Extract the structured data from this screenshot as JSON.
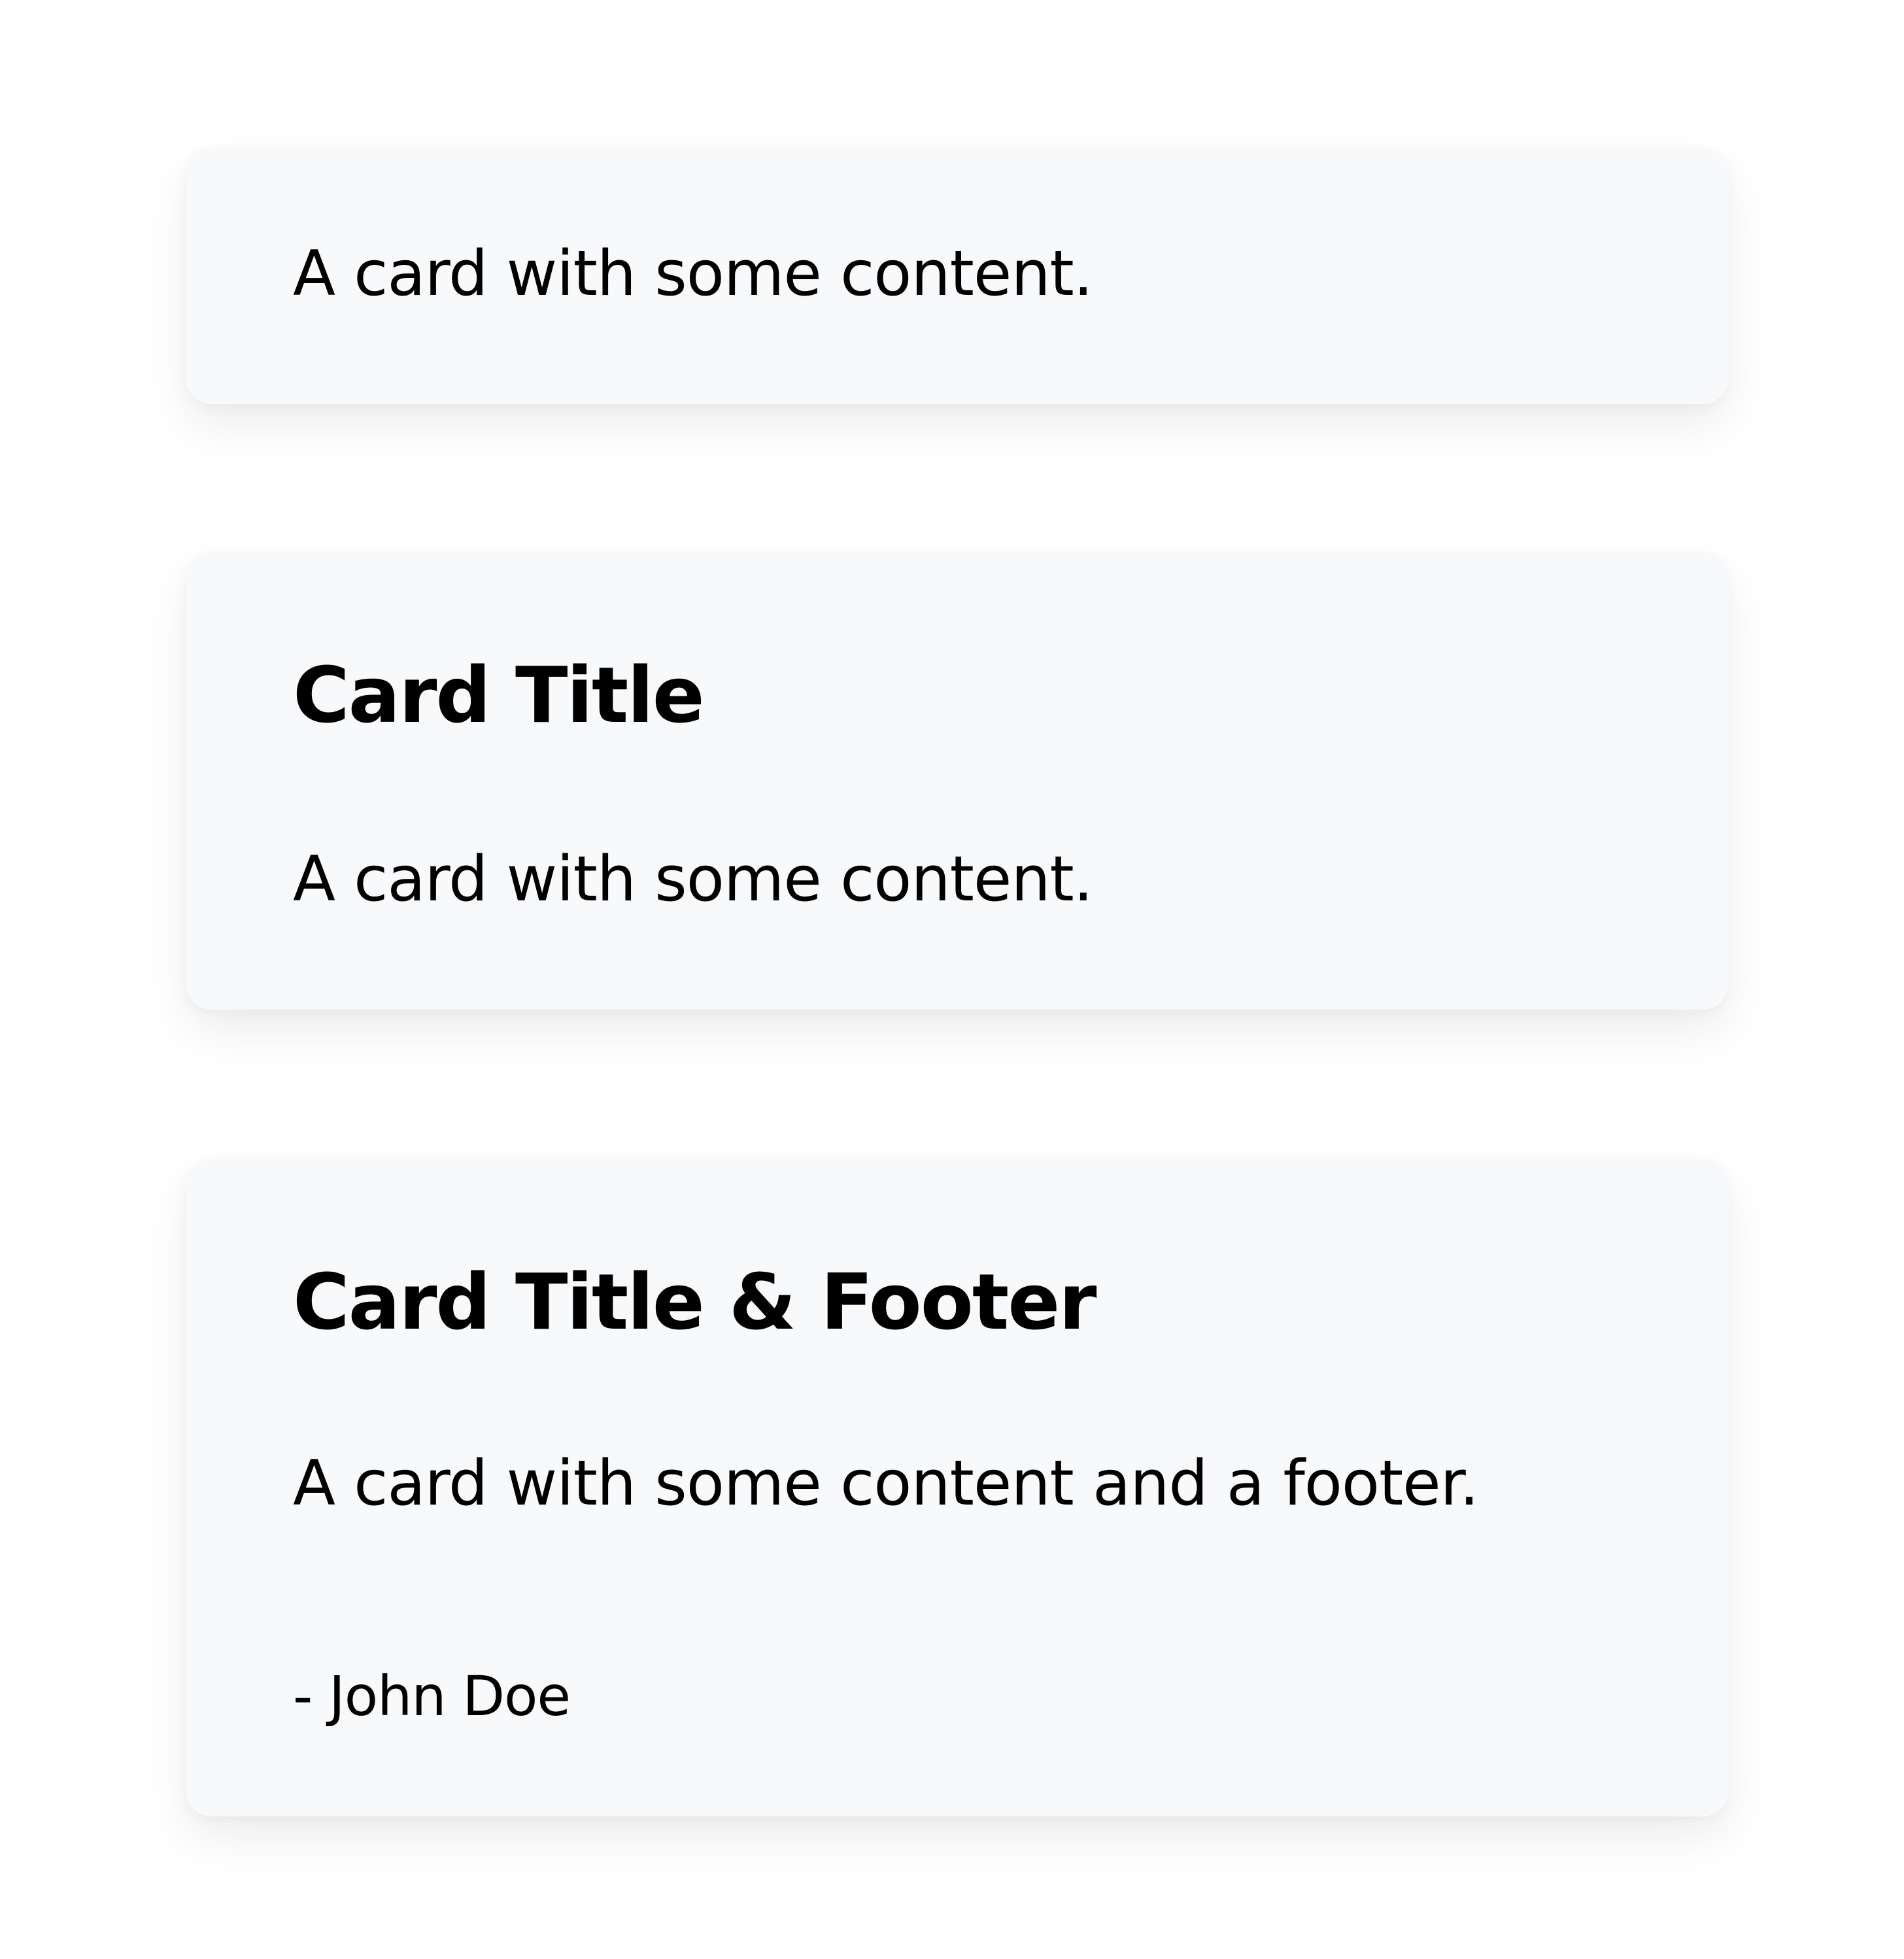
{
  "cards": [
    {
      "content": "A card with some content."
    },
    {
      "title": "Card Title",
      "content": "A card with some content."
    },
    {
      "title": "Card Title & Footer",
      "content": "A card with some content and a footer.",
      "footer": "- John Doe"
    }
  ],
  "colors": {
    "page_background": "#ffffff",
    "card_background": "#f8f9fb",
    "text": "#000000"
  }
}
